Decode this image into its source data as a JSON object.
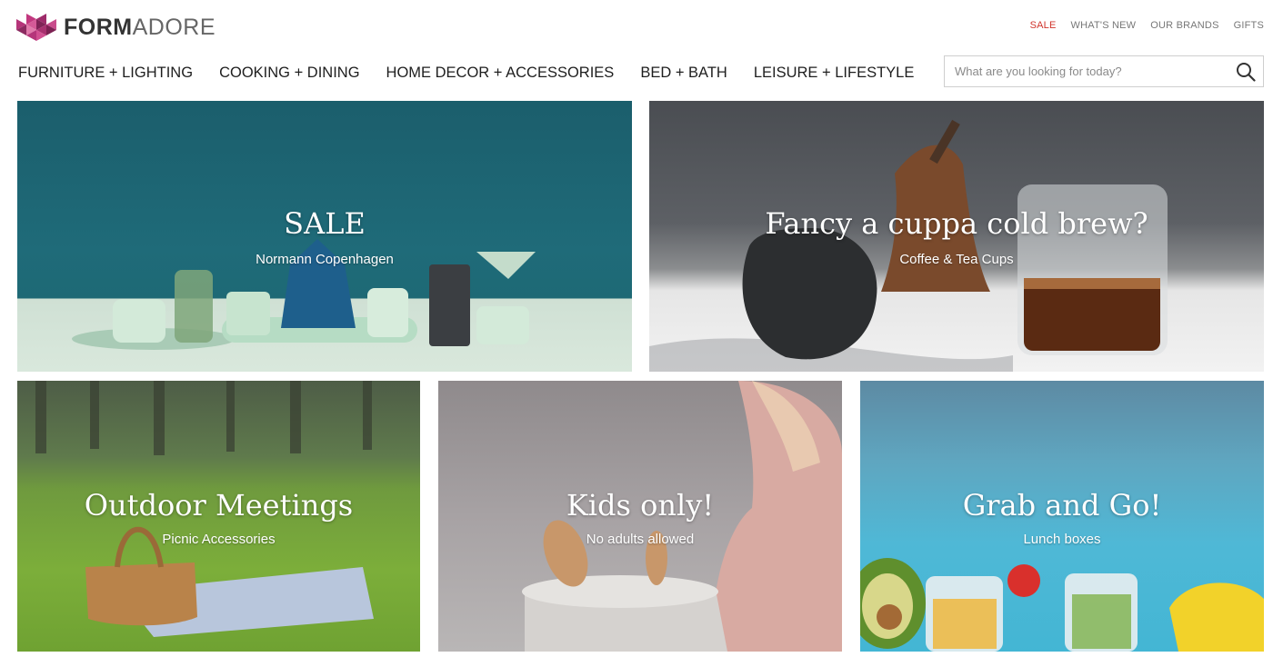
{
  "brand": {
    "bold": "FORM",
    "light": "ADORE"
  },
  "top_links": [
    {
      "label": "SALE",
      "accent": "#d0342c"
    },
    {
      "label": "WHAT'S NEW"
    },
    {
      "label": "OUR BRANDS"
    },
    {
      "label": "GIFTS"
    }
  ],
  "nav": [
    "FURNITURE + LIGHTING",
    "COOKING + DINING",
    "HOME DECOR + ACCESSORIES",
    "BED + BATH",
    "LEISURE + LIFESTYLE"
  ],
  "search": {
    "placeholder": "What are you looking for today?",
    "icon": "search-icon"
  },
  "tiles": [
    {
      "title": "SALE",
      "subtitle": "Normann Copenhagen"
    },
    {
      "title": "Fancy a cuppa cold brew?",
      "subtitle": "Coffee & Tea Cups"
    },
    {
      "title": "Outdoor Meetings",
      "subtitle": "Picnic Accessories"
    },
    {
      "title": "Kids only!",
      "subtitle": "No adults allowed"
    },
    {
      "title": "Grab and Go!",
      "subtitle": "Lunch boxes"
    }
  ],
  "colors": {
    "sale_accent": "#d0342c",
    "logo_magenta": "#b5357a"
  }
}
